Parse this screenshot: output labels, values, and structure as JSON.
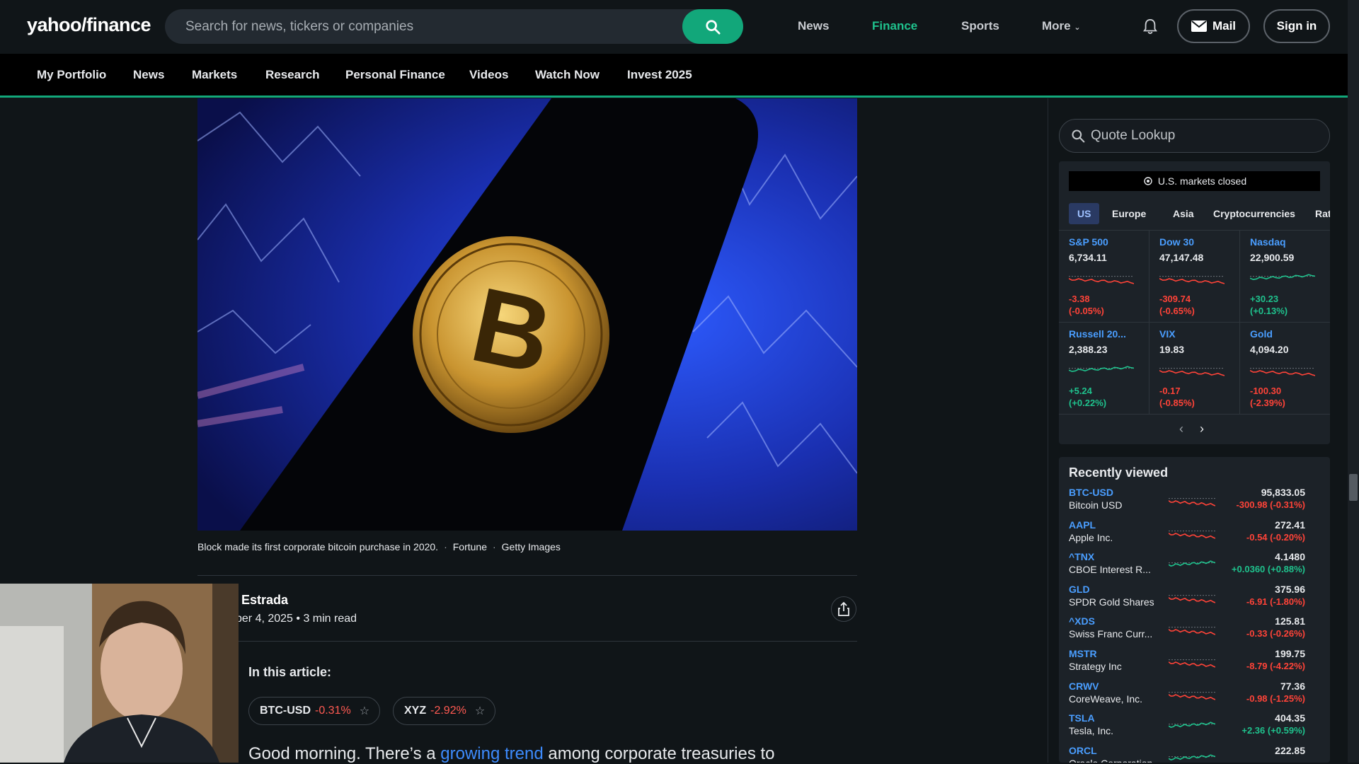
{
  "header": {
    "logo_text": "yahoo/finance",
    "search_placeholder": "Search for news, tickers or companies",
    "nav": [
      "News",
      "Finance",
      "Sports",
      "More"
    ],
    "mail_label": "Mail",
    "signin_label": "Sign in",
    "accent": "#1fc28d"
  },
  "subnav": [
    "My Portfolio",
    "News",
    "Markets",
    "Research",
    "Personal Finance",
    "Videos",
    "Watch Now",
    "Invest 2025"
  ],
  "article": {
    "caption": "Block made its first corporate bitcoin purchase in 2020.",
    "source": "Fortune",
    "photo_credit": "Getty Images",
    "author": "Estrada",
    "byline": "ber 4, 2025 • 3 min read",
    "in_article_label": "In this article:",
    "tickers": [
      {
        "symbol": "BTC-USD",
        "change": "-0.31%"
      },
      {
        "symbol": "XYZ",
        "change": "-2.92%"
      }
    ],
    "body_start": "Good morning. There’s a ",
    "body_link": "growing trend",
    "body_end": " among corporate treasuries to"
  },
  "sidebar": {
    "quote_placeholder": "Quote Lookup",
    "market_status": "U.S. markets closed",
    "tabs": [
      "US",
      "Europe",
      "Asia",
      "Cryptocurrencies",
      "Rate"
    ],
    "indices": [
      {
        "name": "S&P 500",
        "price": "6,734.11",
        "chg": "-3.38",
        "pct": "(-0.05%)",
        "dir": "neg"
      },
      {
        "name": "Dow 30",
        "price": "47,147.48",
        "chg": "-309.74",
        "pct": "(-0.65%)",
        "dir": "neg"
      },
      {
        "name": "Nasdaq",
        "price": "22,900.59",
        "chg": "+30.23",
        "pct": "(+0.13%)",
        "dir": "pos"
      },
      {
        "name": "Russell 20...",
        "price": "2,388.23",
        "chg": "+5.24",
        "pct": "(+0.22%)",
        "dir": "pos"
      },
      {
        "name": "VIX",
        "price": "19.83",
        "chg": "-0.17",
        "pct": "(-0.85%)",
        "dir": "neg"
      },
      {
        "name": "Gold",
        "price": "4,094.20",
        "chg": "-100.30",
        "pct": "(-2.39%)",
        "dir": "neg"
      }
    ],
    "recent_title": "Recently viewed",
    "recent": [
      {
        "symbol": "BTC-USD",
        "name": "Bitcoin USD",
        "price": "95,833.05",
        "chg": "-300.98 (-0.31%)",
        "dir": "neg"
      },
      {
        "symbol": "AAPL",
        "name": "Apple Inc.",
        "price": "272.41",
        "chg": "-0.54 (-0.20%)",
        "dir": "neg"
      },
      {
        "symbol": "^TNX",
        "name": "CBOE Interest R...",
        "price": "4.1480",
        "chg": "+0.0360 (+0.88%)",
        "dir": "pos"
      },
      {
        "symbol": "GLD",
        "name": "SPDR Gold Shares",
        "price": "375.96",
        "chg": "-6.91 (-1.80%)",
        "dir": "neg"
      },
      {
        "symbol": "^XDS",
        "name": "Swiss Franc Curr...",
        "price": "125.81",
        "chg": "-0.33 (-0.26%)",
        "dir": "neg"
      },
      {
        "symbol": "MSTR",
        "name": "Strategy Inc",
        "price": "199.75",
        "chg": "-8.79 (-4.22%)",
        "dir": "neg"
      },
      {
        "symbol": "CRWV",
        "name": "CoreWeave, Inc.",
        "price": "77.36",
        "chg": "-0.98 (-1.25%)",
        "dir": "neg"
      },
      {
        "symbol": "TSLA",
        "name": "Tesla, Inc.",
        "price": "404.35",
        "chg": "+2.36 (+0.59%)",
        "dir": "pos"
      },
      {
        "symbol": "ORCL",
        "name": "Oracle Corporation",
        "price": "222.85",
        "chg": "",
        "dir": "pos"
      }
    ]
  }
}
